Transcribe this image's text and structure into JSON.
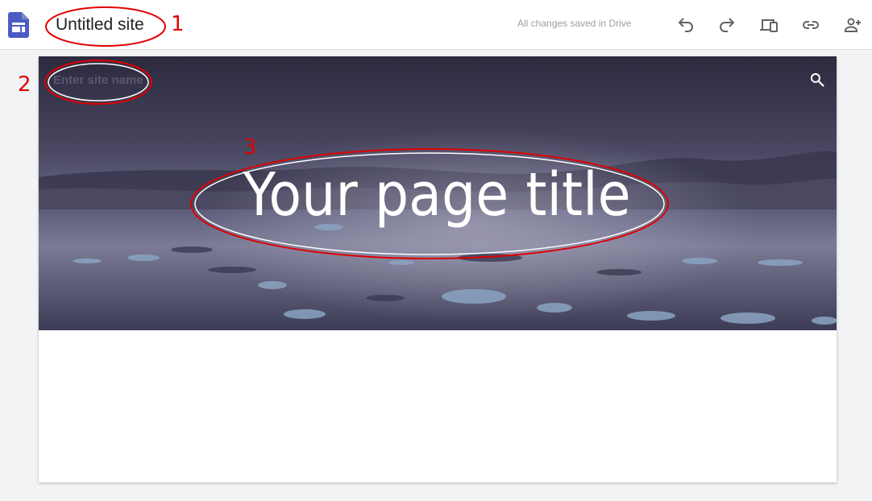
{
  "header": {
    "title": "Untitled site",
    "save_status": "All changes saved in Drive",
    "actions": [
      {
        "name": "undo",
        "icon": "undo-icon"
      },
      {
        "name": "redo",
        "icon": "redo-icon"
      },
      {
        "name": "preview",
        "icon": "devices-icon"
      },
      {
        "name": "copy-link",
        "icon": "link-icon"
      },
      {
        "name": "share",
        "icon": "person-add-icon"
      }
    ]
  },
  "site": {
    "name_placeholder": "Enter site name",
    "page_title": "Your page title",
    "search_icon": "search-icon"
  },
  "annotations": {
    "labels": [
      "1",
      "2",
      "3"
    ],
    "color": "#e00000"
  },
  "colors": {
    "brand": "#4b5bc4",
    "annotation": "#e00000"
  }
}
